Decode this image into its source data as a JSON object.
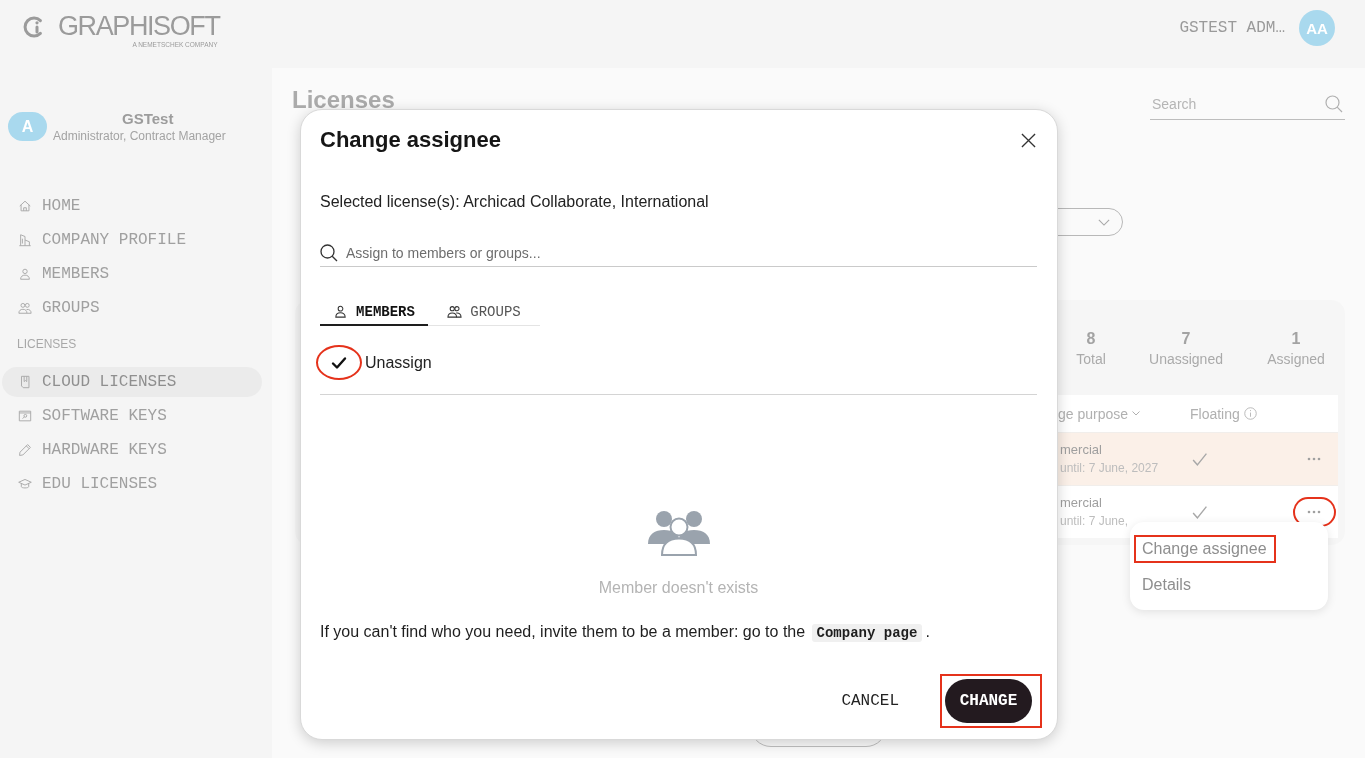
{
  "header": {
    "logo": {
      "wordmark": "GRAPHISOFT",
      "tagline": "A NEMETSCHEK COMPANY"
    },
    "user": {
      "name": "GSTEST ADM…",
      "initials": "AA"
    }
  },
  "sidebar": {
    "user": {
      "initials": "A",
      "name": "GSTest",
      "role": "Administrator, Contract Manager"
    },
    "items": [
      {
        "label": "HOME",
        "selected": false
      },
      {
        "label": "COMPANY PROFILE",
        "selected": false
      },
      {
        "label": "MEMBERS",
        "selected": false
      },
      {
        "label": "GROUPS",
        "selected": false
      }
    ],
    "section": {
      "title": "LICENSES",
      "items": [
        {
          "label": "CLOUD LICENSES",
          "selected": true
        },
        {
          "label": "SOFTWARE KEYS",
          "selected": false
        },
        {
          "label": "HARDWARE KEYS",
          "selected": false
        },
        {
          "label": "EDU LICENSES",
          "selected": false
        }
      ]
    }
  },
  "main": {
    "title": "Licenses",
    "search": {
      "placeholder": "Search"
    },
    "summary": [
      {
        "value": "8",
        "label": "Total"
      },
      {
        "value": "7",
        "label": "Unassigned"
      },
      {
        "value": "1",
        "label": "Assigned"
      }
    ],
    "table": {
      "columns": [
        {
          "label": "ge purpose",
          "sortable": true
        },
        {
          "label": "Floating",
          "info": true
        }
      ],
      "rows": [
        {
          "purpose": "mercial",
          "validity": "until: 7 June, 2027",
          "floating": true,
          "hovered": true,
          "annotated": false
        },
        {
          "purpose": "mercial",
          "validity": "until: 7 June,",
          "floating": true,
          "hovered": false,
          "annotated": true
        }
      ]
    },
    "row_menu": {
      "items": [
        {
          "label": "Change assignee",
          "annotated": true
        },
        {
          "label": "Details",
          "annotated": false
        }
      ]
    }
  },
  "dialog": {
    "title": "Change assignee",
    "selection": "Selected license(s): Archicad Collaborate, International",
    "search": {
      "placeholder": "Assign to members or groups..."
    },
    "tabs": [
      {
        "label": "MEMBERS",
        "selected": true
      },
      {
        "label": "GROUPS",
        "selected": false
      }
    ],
    "options": [
      {
        "label": "Unassign",
        "checked": true,
        "annotated": true
      }
    ],
    "empty_state": {
      "text": "Member doesn't exists"
    },
    "hint": {
      "text": "If you can't find who you need, invite them to be a member: go to the",
      "link": "Company page",
      "end": "."
    },
    "buttons": [
      {
        "label": "CANCEL",
        "kind": "secondary",
        "annotated": false
      },
      {
        "label": "CHANGE",
        "kind": "primary",
        "annotated": true
      }
    ]
  }
}
